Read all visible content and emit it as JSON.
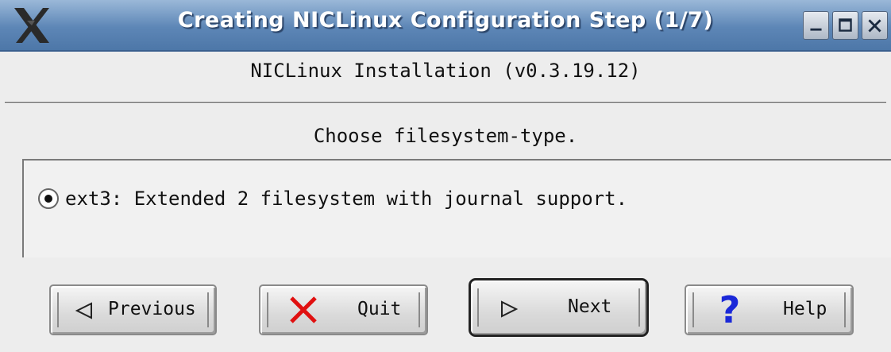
{
  "window": {
    "title": "Creating NICLinux Configuration Step (1/7)",
    "controls": [
      "minimize-icon",
      "maximize-icon",
      "close-icon"
    ]
  },
  "header": {
    "subtitle": "NICLinux Installation (v0.3.19.12)"
  },
  "main": {
    "prompt": "Choose filesystem-type.",
    "options": [
      {
        "label": "ext3: Extended 2 filesystem with journal support.",
        "selected": true
      }
    ]
  },
  "buttons": {
    "previous": {
      "label": "Previous",
      "icon": "left-triangle-icon"
    },
    "quit": {
      "label": "Quit",
      "icon": "red-x-icon"
    },
    "next": {
      "label": "Next",
      "icon": "right-triangle-icon"
    },
    "help": {
      "label": "Help",
      "icon": "question-mark-icon"
    }
  },
  "colors": {
    "titlebar": "#5d86b6",
    "quit_icon": "#e01010",
    "help_icon": "#1a28d8"
  }
}
